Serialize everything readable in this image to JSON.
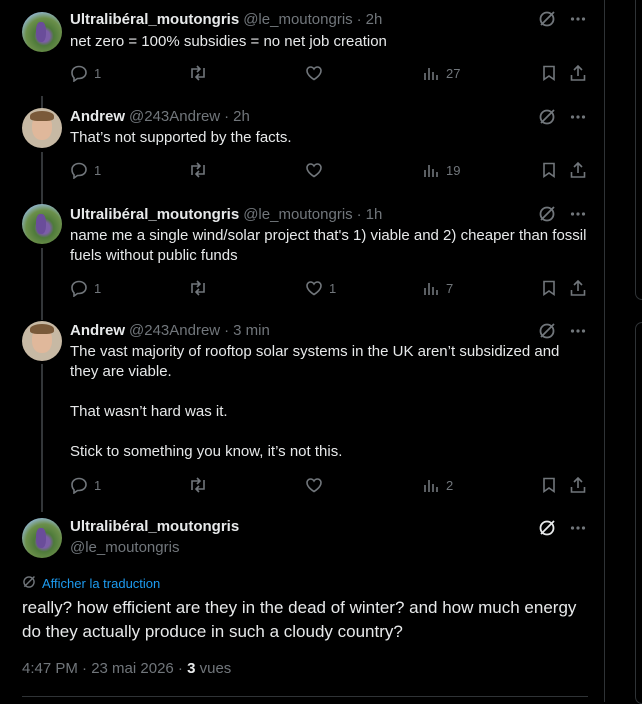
{
  "tweets": [
    {
      "name": "Ultralibéral_moutongris",
      "handle": "@le_moutongris",
      "sep": "·",
      "time": "2h",
      "text": "net zero = 100% subsidies = no net job creation",
      "replies": "1",
      "likes": "",
      "views": "27"
    },
    {
      "name": "Andrew",
      "handle": "@243Andrew",
      "sep": "·",
      "time": "2h",
      "text": "That’s not supported by the facts.",
      "replies": "1",
      "likes": "",
      "views": "19"
    },
    {
      "name": "Ultralibéral_moutongris",
      "handle": "@le_moutongris",
      "sep": "·",
      "time": "1h",
      "text": "name me a single wind/solar project that's 1) viable and 2) cheaper than fossil fuels without public funds",
      "replies": "1",
      "likes": "1",
      "views": "7"
    },
    {
      "name": "Andrew",
      "handle": "@243Andrew",
      "sep": "·",
      "time": "3 min",
      "text": "The vast majority of rooftop solar systems in the UK aren’t subsidized and they are viable.\n\nThat wasn’t hard was it.\n\nStick to something you know, it’s not this.",
      "replies": "1",
      "likes": "",
      "views": "2"
    }
  ],
  "main_tweet": {
    "name": "Ultralibéral_moutongris",
    "handle": "@le_moutongris",
    "translate_label": "Afficher la traduction",
    "text": "really? how efficient are they in the dead of winter? and how much energy do they actually produce in such a cloudy country?",
    "timestamp": "4:47 PM · 23 mai 2026 · ",
    "views_count": "3",
    "views_label": " vues"
  },
  "icons": {
    "reply": "reply-icon",
    "retweet": "retweet-icon",
    "like": "heart-icon",
    "views": "views-chart-icon",
    "bookmark": "bookmark-icon",
    "share": "share-icon",
    "grok": "grok-icon",
    "more": "more-icon"
  },
  "colors": {
    "background": "#000000",
    "text": "#e7e9ea",
    "muted": "#71767b",
    "link": "#1d9bf0",
    "border": "#2f3336"
  }
}
